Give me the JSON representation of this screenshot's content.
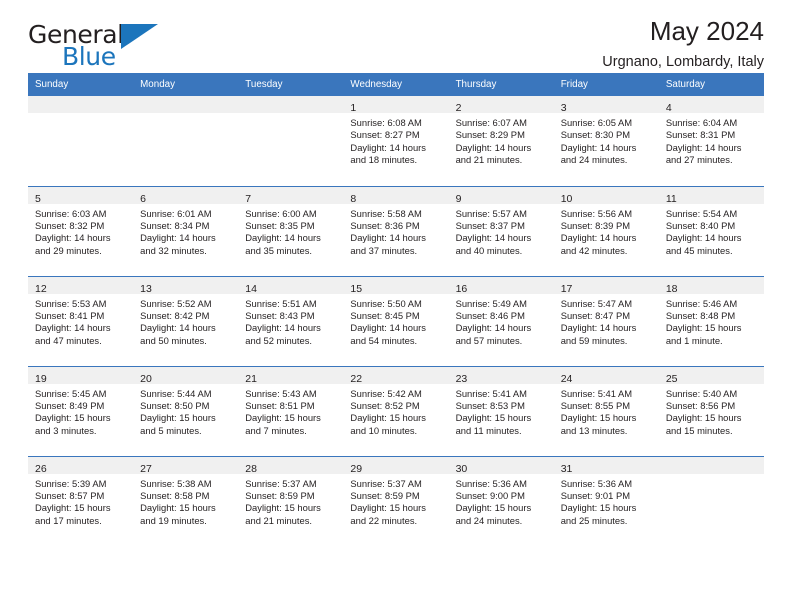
{
  "brand": {
    "name_top": "General",
    "name_bottom": "Blue",
    "colors": {
      "blue": "#1c75bc",
      "dark": "#231f20"
    }
  },
  "header": {
    "title": "May 2024",
    "subtitle": "Urgnano, Lombardy, Italy"
  },
  "calendar": {
    "accent_color": "#3a76bd",
    "daynum_band_color": "#f0f0f0",
    "weekdays": [
      "Sunday",
      "Monday",
      "Tuesday",
      "Wednesday",
      "Thursday",
      "Friday",
      "Saturday"
    ],
    "weeks": [
      [
        {
          "day": ""
        },
        {
          "day": ""
        },
        {
          "day": ""
        },
        {
          "day": "1",
          "sunrise": "Sunrise: 6:08 AM",
          "sunset": "Sunset: 8:27 PM",
          "daylight1": "Daylight: 14 hours",
          "daylight2": "and 18 minutes."
        },
        {
          "day": "2",
          "sunrise": "Sunrise: 6:07 AM",
          "sunset": "Sunset: 8:29 PM",
          "daylight1": "Daylight: 14 hours",
          "daylight2": "and 21 minutes."
        },
        {
          "day": "3",
          "sunrise": "Sunrise: 6:05 AM",
          "sunset": "Sunset: 8:30 PM",
          "daylight1": "Daylight: 14 hours",
          "daylight2": "and 24 minutes."
        },
        {
          "day": "4",
          "sunrise": "Sunrise: 6:04 AM",
          "sunset": "Sunset: 8:31 PM",
          "daylight1": "Daylight: 14 hours",
          "daylight2": "and 27 minutes."
        }
      ],
      [
        {
          "day": "5",
          "sunrise": "Sunrise: 6:03 AM",
          "sunset": "Sunset: 8:32 PM",
          "daylight1": "Daylight: 14 hours",
          "daylight2": "and 29 minutes."
        },
        {
          "day": "6",
          "sunrise": "Sunrise: 6:01 AM",
          "sunset": "Sunset: 8:34 PM",
          "daylight1": "Daylight: 14 hours",
          "daylight2": "and 32 minutes."
        },
        {
          "day": "7",
          "sunrise": "Sunrise: 6:00 AM",
          "sunset": "Sunset: 8:35 PM",
          "daylight1": "Daylight: 14 hours",
          "daylight2": "and 35 minutes."
        },
        {
          "day": "8",
          "sunrise": "Sunrise: 5:58 AM",
          "sunset": "Sunset: 8:36 PM",
          "daylight1": "Daylight: 14 hours",
          "daylight2": "and 37 minutes."
        },
        {
          "day": "9",
          "sunrise": "Sunrise: 5:57 AM",
          "sunset": "Sunset: 8:37 PM",
          "daylight1": "Daylight: 14 hours",
          "daylight2": "and 40 minutes."
        },
        {
          "day": "10",
          "sunrise": "Sunrise: 5:56 AM",
          "sunset": "Sunset: 8:39 PM",
          "daylight1": "Daylight: 14 hours",
          "daylight2": "and 42 minutes."
        },
        {
          "day": "11",
          "sunrise": "Sunrise: 5:54 AM",
          "sunset": "Sunset: 8:40 PM",
          "daylight1": "Daylight: 14 hours",
          "daylight2": "and 45 minutes."
        }
      ],
      [
        {
          "day": "12",
          "sunrise": "Sunrise: 5:53 AM",
          "sunset": "Sunset: 8:41 PM",
          "daylight1": "Daylight: 14 hours",
          "daylight2": "and 47 minutes."
        },
        {
          "day": "13",
          "sunrise": "Sunrise: 5:52 AM",
          "sunset": "Sunset: 8:42 PM",
          "daylight1": "Daylight: 14 hours",
          "daylight2": "and 50 minutes."
        },
        {
          "day": "14",
          "sunrise": "Sunrise: 5:51 AM",
          "sunset": "Sunset: 8:43 PM",
          "daylight1": "Daylight: 14 hours",
          "daylight2": "and 52 minutes."
        },
        {
          "day": "15",
          "sunrise": "Sunrise: 5:50 AM",
          "sunset": "Sunset: 8:45 PM",
          "daylight1": "Daylight: 14 hours",
          "daylight2": "and 54 minutes."
        },
        {
          "day": "16",
          "sunrise": "Sunrise: 5:49 AM",
          "sunset": "Sunset: 8:46 PM",
          "daylight1": "Daylight: 14 hours",
          "daylight2": "and 57 minutes."
        },
        {
          "day": "17",
          "sunrise": "Sunrise: 5:47 AM",
          "sunset": "Sunset: 8:47 PM",
          "daylight1": "Daylight: 14 hours",
          "daylight2": "and 59 minutes."
        },
        {
          "day": "18",
          "sunrise": "Sunrise: 5:46 AM",
          "sunset": "Sunset: 8:48 PM",
          "daylight1": "Daylight: 15 hours",
          "daylight2": "and 1 minute."
        }
      ],
      [
        {
          "day": "19",
          "sunrise": "Sunrise: 5:45 AM",
          "sunset": "Sunset: 8:49 PM",
          "daylight1": "Daylight: 15 hours",
          "daylight2": "and 3 minutes."
        },
        {
          "day": "20",
          "sunrise": "Sunrise: 5:44 AM",
          "sunset": "Sunset: 8:50 PM",
          "daylight1": "Daylight: 15 hours",
          "daylight2": "and 5 minutes."
        },
        {
          "day": "21",
          "sunrise": "Sunrise: 5:43 AM",
          "sunset": "Sunset: 8:51 PM",
          "daylight1": "Daylight: 15 hours",
          "daylight2": "and 7 minutes."
        },
        {
          "day": "22",
          "sunrise": "Sunrise: 5:42 AM",
          "sunset": "Sunset: 8:52 PM",
          "daylight1": "Daylight: 15 hours",
          "daylight2": "and 10 minutes."
        },
        {
          "day": "23",
          "sunrise": "Sunrise: 5:41 AM",
          "sunset": "Sunset: 8:53 PM",
          "daylight1": "Daylight: 15 hours",
          "daylight2": "and 11 minutes."
        },
        {
          "day": "24",
          "sunrise": "Sunrise: 5:41 AM",
          "sunset": "Sunset: 8:55 PM",
          "daylight1": "Daylight: 15 hours",
          "daylight2": "and 13 minutes."
        },
        {
          "day": "25",
          "sunrise": "Sunrise: 5:40 AM",
          "sunset": "Sunset: 8:56 PM",
          "daylight1": "Daylight: 15 hours",
          "daylight2": "and 15 minutes."
        }
      ],
      [
        {
          "day": "26",
          "sunrise": "Sunrise: 5:39 AM",
          "sunset": "Sunset: 8:57 PM",
          "daylight1": "Daylight: 15 hours",
          "daylight2": "and 17 minutes."
        },
        {
          "day": "27",
          "sunrise": "Sunrise: 5:38 AM",
          "sunset": "Sunset: 8:58 PM",
          "daylight1": "Daylight: 15 hours",
          "daylight2": "and 19 minutes."
        },
        {
          "day": "28",
          "sunrise": "Sunrise: 5:37 AM",
          "sunset": "Sunset: 8:59 PM",
          "daylight1": "Daylight: 15 hours",
          "daylight2": "and 21 minutes."
        },
        {
          "day": "29",
          "sunrise": "Sunrise: 5:37 AM",
          "sunset": "Sunset: 8:59 PM",
          "daylight1": "Daylight: 15 hours",
          "daylight2": "and 22 minutes."
        },
        {
          "day": "30",
          "sunrise": "Sunrise: 5:36 AM",
          "sunset": "Sunset: 9:00 PM",
          "daylight1": "Daylight: 15 hours",
          "daylight2": "and 24 minutes."
        },
        {
          "day": "31",
          "sunrise": "Sunrise: 5:36 AM",
          "sunset": "Sunset: 9:01 PM",
          "daylight1": "Daylight: 15 hours",
          "daylight2": "and 25 minutes."
        },
        {
          "day": ""
        }
      ]
    ]
  }
}
